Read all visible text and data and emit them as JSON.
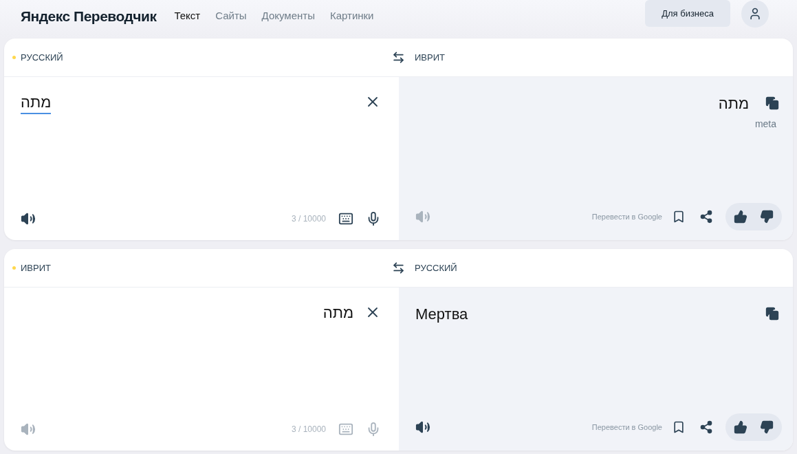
{
  "header": {
    "logo": "Яндекс Переводчик",
    "nav": [
      {
        "label": "Текст",
        "selected": true
      },
      {
        "label": "Сайты",
        "selected": false
      },
      {
        "label": "Документы",
        "selected": false
      },
      {
        "label": "Картинки",
        "selected": false
      }
    ],
    "business_button": "Для бизнеса"
  },
  "panels": [
    {
      "source_language": "РУССКИЙ",
      "target_language": "ИВРИТ",
      "source": {
        "text": "מתה",
        "rtl": false,
        "underlined": true,
        "counter": "3 / 10000",
        "disabled": false
      },
      "translation": {
        "text": "מתה",
        "rtl": true,
        "transliteration": "meta",
        "speaker_disabled": true
      },
      "google_link": "Перевести в Google"
    },
    {
      "source_language": "ИВРИТ",
      "target_language": "РУССКИЙ",
      "source": {
        "text": "מתה",
        "rtl": true,
        "underlined": false,
        "counter": "3 / 10000",
        "disabled": true
      },
      "translation": {
        "text": "Мертва",
        "rtl": false,
        "speaker_disabled": false
      },
      "google_link": "Перевести в Google"
    }
  ]
}
